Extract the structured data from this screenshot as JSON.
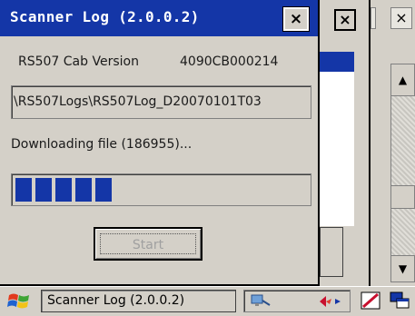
{
  "dialog": {
    "title": "Scanner Log (2.0.0.2)",
    "close_glyph": "×",
    "cab_version_label": "RS507 Cab Version",
    "cab_version_value": "4090CB000214",
    "log_path": "\\RS507Logs\\RS507Log_D20070101T03",
    "status_text": "Downloading file (186955)...",
    "progress_segments": 5,
    "start_button_label": "Start"
  },
  "background_windows": {
    "close_glyph": "×",
    "scroll_up_glyph": "▲",
    "scroll_down_glyph": "▼"
  },
  "taskbar": {
    "task_label": "Scanner Log (2.0.0.2)"
  },
  "colors": {
    "titlebar": "#1436a7",
    "progress_fill": "#1436a7",
    "window_face": "#d4d0c8"
  }
}
